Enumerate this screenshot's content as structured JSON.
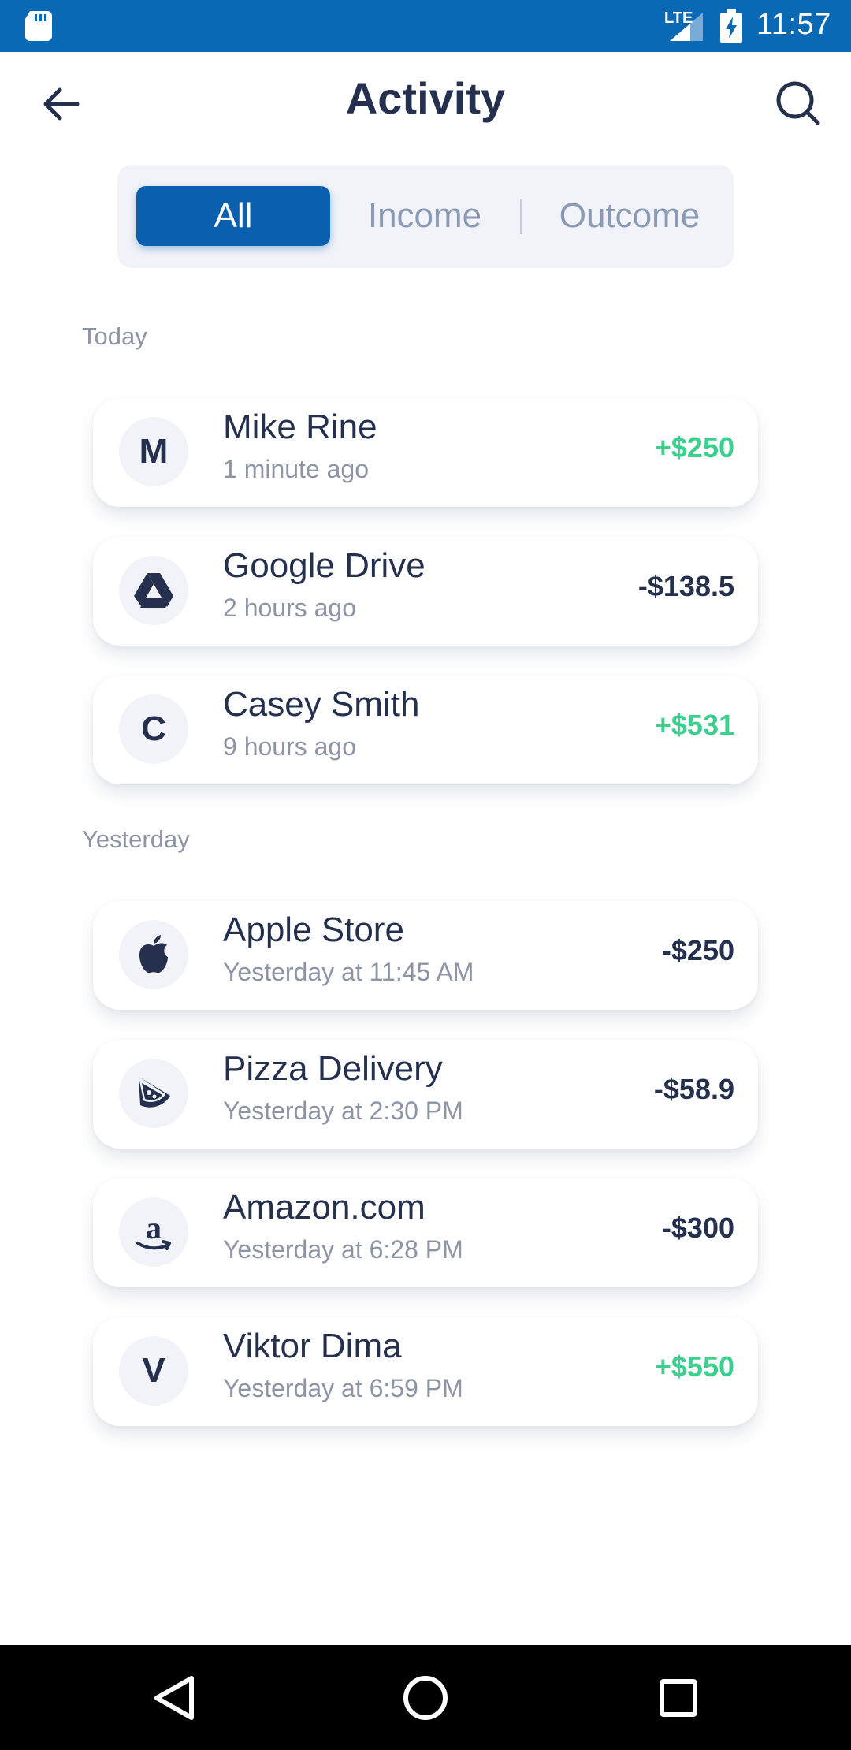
{
  "status_bar": {
    "network": "LTE",
    "time": "11:57"
  },
  "header": {
    "title": "Activity"
  },
  "tabs": [
    {
      "label": "All",
      "selected": true
    },
    {
      "label": "Income",
      "selected": false
    },
    {
      "label": "Outcome",
      "selected": false
    }
  ],
  "sections": [
    {
      "heading": "Today",
      "items": [
        {
          "avatar": "M",
          "icon": "letter-avatar",
          "name": "Mike Rine",
          "time": "1 minute ago",
          "amount": "+$250",
          "type": "income"
        },
        {
          "avatar": "",
          "icon": "google-drive-icon",
          "name": "Google Drive",
          "time": "2 hours ago",
          "amount": "-$138.5",
          "type": "outcome"
        },
        {
          "avatar": "C",
          "icon": "letter-avatar",
          "name": "Casey Smith",
          "time": "9 hours ago",
          "amount": "+$531",
          "type": "income"
        }
      ]
    },
    {
      "heading": "Yesterday",
      "items": [
        {
          "avatar": "",
          "icon": "apple-icon",
          "name": "Apple Store",
          "time": "Yesterday at 11:45 AM",
          "amount": "-$250",
          "type": "outcome"
        },
        {
          "avatar": "",
          "icon": "pizza-icon",
          "name": "Pizza Delivery",
          "time": "Yesterday at 2:30 PM",
          "amount": "-$58.9",
          "type": "outcome"
        },
        {
          "avatar": "",
          "icon": "amazon-icon",
          "name": "Amazon.com",
          "time": "Yesterday at 6:28 PM",
          "amount": "-$300",
          "type": "outcome"
        },
        {
          "avatar": "V",
          "icon": "letter-avatar",
          "name": "Viktor Dima",
          "time": "Yesterday at 6:59 PM",
          "amount": "+$550",
          "type": "income"
        }
      ]
    }
  ],
  "colors": {
    "status_bar": "#0a69b5",
    "accent": "#0a5fae",
    "income": "#3ccf8e",
    "outcome": "#24304d"
  }
}
